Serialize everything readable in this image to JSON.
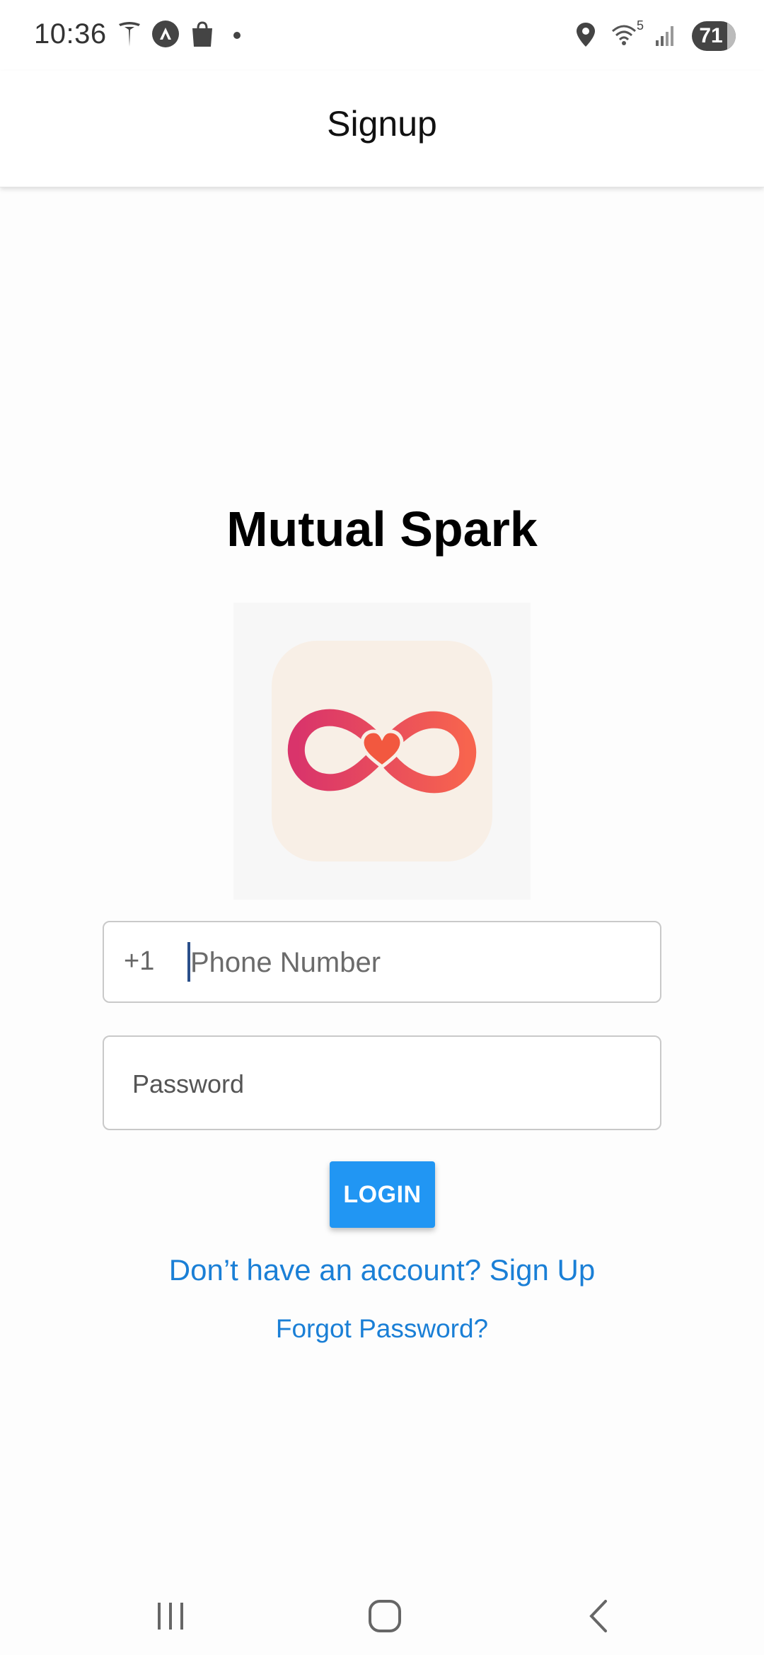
{
  "status_bar": {
    "time": "10:36",
    "left_icons": [
      "tesla-icon",
      "navigation-app-icon",
      "shopping-bag-icon",
      "notification-dot-icon"
    ],
    "right_icons": [
      "location-icon",
      "wifi-icon",
      "signal-icon"
    ],
    "wifi_label": "5",
    "battery": "71"
  },
  "app_bar": {
    "title": "Signup"
  },
  "main": {
    "app_name": "Mutual Spark",
    "logo_icon": "infinity-heart-logo-icon",
    "phone": {
      "country_code": "+1",
      "placeholder": "Phone Number"
    },
    "password": {
      "placeholder": "Password"
    },
    "login_label": "LOGIN",
    "signup_link": "Don’t have an account? Sign Up",
    "forgot_link": "Forgot Password?"
  },
  "nav_bar": {
    "icons": [
      "recent-apps-icon",
      "home-icon",
      "back-icon"
    ]
  },
  "colors": {
    "accent": "#2196f3",
    "link": "#1a7fd6",
    "logo_gradient_start": "#d9346b",
    "logo_gradient_end": "#f7644e"
  }
}
